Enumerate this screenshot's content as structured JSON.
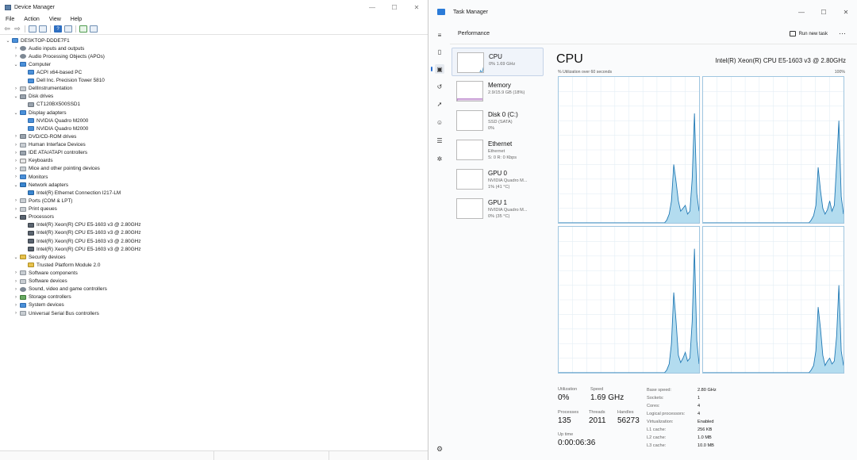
{
  "device_manager": {
    "title": "Device Manager",
    "menu": [
      "File",
      "Action",
      "View",
      "Help"
    ],
    "tree": [
      {
        "level": 0,
        "chev": "⌄",
        "icon": "monitor",
        "label": "DESKTOP-DDDE7F1"
      },
      {
        "level": 1,
        "chev": "›",
        "icon": "sound",
        "label": "Audio inputs and outputs"
      },
      {
        "level": 1,
        "chev": "›",
        "icon": "sound",
        "label": "Audio Processing Objects (APOs)"
      },
      {
        "level": 1,
        "chev": "⌄",
        "icon": "monitor",
        "label": "Computer"
      },
      {
        "level": 2,
        "chev": "",
        "icon": "monitor",
        "label": "ACPI x64-based PC"
      },
      {
        "level": 2,
        "chev": "",
        "icon": "monitor",
        "label": "Dell Inc. Precision Tower 5810"
      },
      {
        "level": 1,
        "chev": "›",
        "icon": "gray",
        "label": "DellInstrumentation"
      },
      {
        "level": 1,
        "chev": "⌄",
        "icon": "disk",
        "label": "Disk drives"
      },
      {
        "level": 2,
        "chev": "",
        "icon": "disk",
        "label": "CT120BX500SSD1"
      },
      {
        "level": 1,
        "chev": "⌄",
        "icon": "monitor",
        "label": "Display adapters"
      },
      {
        "level": 2,
        "chev": "",
        "icon": "monitor",
        "label": "NVIDIA Quadro M2000"
      },
      {
        "level": 2,
        "chev": "",
        "icon": "monitor",
        "label": "NVIDIA Quadro M2000"
      },
      {
        "level": 1,
        "chev": "›",
        "icon": "disk",
        "label": "DVD/CD-ROM drives"
      },
      {
        "level": 1,
        "chev": "›",
        "icon": "gray",
        "label": "Human Interface Devices"
      },
      {
        "level": 1,
        "chev": "›",
        "icon": "disk",
        "label": "IDE ATA/ATAPI controllers"
      },
      {
        "level": 1,
        "chev": "›",
        "icon": "key",
        "label": "Keyboards"
      },
      {
        "level": 1,
        "chev": "›",
        "icon": "gray",
        "label": "Mice and other pointing devices"
      },
      {
        "level": 1,
        "chev": "›",
        "icon": "monitor",
        "label": "Monitors"
      },
      {
        "level": 1,
        "chev": "⌄",
        "icon": "net",
        "label": "Network adapters"
      },
      {
        "level": 2,
        "chev": "",
        "icon": "net",
        "label": "Intel(R) Ethernet Connection I217-LM"
      },
      {
        "level": 1,
        "chev": "›",
        "icon": "gray",
        "label": "Ports (COM & LPT)"
      },
      {
        "level": 1,
        "chev": "›",
        "icon": "gray",
        "label": "Print queues"
      },
      {
        "level": 1,
        "chev": "⌄",
        "icon": "chip",
        "label": "Processors"
      },
      {
        "level": 2,
        "chev": "",
        "icon": "chip",
        "label": "Intel(R) Xeon(R) CPU E5-1603 v3 @ 2.80GHz"
      },
      {
        "level": 2,
        "chev": "",
        "icon": "chip",
        "label": "Intel(R) Xeon(R) CPU E5-1603 v3 @ 2.80GHz"
      },
      {
        "level": 2,
        "chev": "",
        "icon": "chip",
        "label": "Intel(R) Xeon(R) CPU E5-1603 v3 @ 2.80GHz"
      },
      {
        "level": 2,
        "chev": "",
        "icon": "chip",
        "label": "Intel(R) Xeon(R) CPU E5-1603 v3 @ 2.80GHz"
      },
      {
        "level": 1,
        "chev": "⌄",
        "icon": "yellow",
        "label": "Security devices"
      },
      {
        "level": 2,
        "chev": "",
        "icon": "yellow",
        "label": "Trusted Platform Module 2.0"
      },
      {
        "level": 1,
        "chev": "›",
        "icon": "gray",
        "label": "Software components"
      },
      {
        "level": 1,
        "chev": "›",
        "icon": "gray",
        "label": "Software devices"
      },
      {
        "level": 1,
        "chev": "›",
        "icon": "sound",
        "label": "Sound, video and game controllers"
      },
      {
        "level": 1,
        "chev": "›",
        "icon": "green",
        "label": "Storage controllers"
      },
      {
        "level": 1,
        "chev": "›",
        "icon": "monitor",
        "label": "System devices"
      },
      {
        "level": 1,
        "chev": "›",
        "icon": "gray",
        "label": "Universal Serial Bus controllers"
      }
    ]
  },
  "task_manager": {
    "title": "Task Manager",
    "page": "Performance",
    "run_new_task": "Run new task",
    "items": [
      {
        "name": "CPU",
        "sub1": "0% 1.69 GHz",
        "sub2": "",
        "color": "#3c8dc4"
      },
      {
        "name": "Memory",
        "sub1": "2.9/15.9 GB (18%)",
        "sub2": "",
        "color": "#9b4fb5"
      },
      {
        "name": "Disk 0 (C:)",
        "sub1": "SSD (SATA)",
        "sub2": "0%",
        "color": "#4d9a3a"
      },
      {
        "name": "Ethernet",
        "sub1": "Ethernet",
        "sub2": "S: 0 R: 0 Kbps",
        "color": "#a35b52"
      },
      {
        "name": "GPU 0",
        "sub1": "NVIDIA Quadro M...",
        "sub2": "1% (41 °C)",
        "color": "#7b5cc1"
      },
      {
        "name": "GPU 1",
        "sub1": "NVIDIA Quadro M...",
        "sub2": "0% (35 °C)",
        "color": "#7b5cc1"
      }
    ],
    "cpu": {
      "heading": "CPU",
      "model": "Intel(R) Xeon(R) CPU E5-1603 v3 @ 2.80GHz",
      "util_label": "% Utilization over 60 seconds",
      "max_label": "100%",
      "graph_color": "#1f78b4",
      "fill_color": "#b3dcef",
      "graph_series": [
        [
          0,
          0,
          0,
          0,
          0,
          0,
          0,
          0,
          0,
          0,
          0,
          0,
          0,
          0,
          0,
          0,
          0,
          0,
          0,
          0,
          0,
          0,
          0,
          0,
          0,
          0,
          0,
          0,
          0,
          0,
          0,
          0,
          0,
          0,
          0,
          0,
          0,
          0,
          0,
          0,
          0,
          0,
          0,
          0,
          0,
          0,
          0,
          2,
          6,
          15,
          40,
          28,
          15,
          8,
          10,
          12,
          6,
          8,
          30,
          75,
          20,
          8
        ],
        [
          0,
          0,
          0,
          0,
          0,
          0,
          0,
          0,
          0,
          0,
          0,
          0,
          0,
          0,
          0,
          0,
          0,
          0,
          0,
          0,
          0,
          0,
          0,
          0,
          0,
          0,
          0,
          0,
          0,
          0,
          0,
          0,
          0,
          0,
          0,
          0,
          0,
          0,
          0,
          0,
          0,
          0,
          0,
          0,
          0,
          0,
          0,
          2,
          5,
          12,
          38,
          22,
          10,
          6,
          9,
          15,
          8,
          12,
          40,
          70,
          18,
          6
        ],
        [
          0,
          0,
          0,
          0,
          0,
          0,
          0,
          0,
          0,
          0,
          0,
          0,
          0,
          0,
          0,
          0,
          0,
          0,
          0,
          0,
          0,
          0,
          0,
          0,
          0,
          0,
          0,
          0,
          0,
          0,
          0,
          0,
          0,
          0,
          0,
          0,
          0,
          0,
          0,
          0,
          0,
          0,
          0,
          0,
          0,
          0,
          0,
          2,
          6,
          20,
          55,
          35,
          12,
          7,
          10,
          14,
          8,
          10,
          35,
          85,
          22,
          6
        ],
        [
          0,
          0,
          0,
          0,
          0,
          0,
          0,
          0,
          0,
          0,
          0,
          0,
          0,
          0,
          0,
          0,
          0,
          0,
          0,
          0,
          0,
          0,
          0,
          0,
          0,
          0,
          0,
          0,
          0,
          0,
          0,
          0,
          0,
          0,
          0,
          0,
          0,
          0,
          0,
          0,
          0,
          0,
          0,
          0,
          0,
          0,
          0,
          2,
          5,
          15,
          45,
          30,
          12,
          5,
          8,
          10,
          6,
          8,
          25,
          60,
          15,
          5
        ]
      ],
      "stats": {
        "utilization_label": "Utilization",
        "utilization": "0%",
        "speed_label": "Speed",
        "speed": "1.69 GHz",
        "processes_label": "Processes",
        "processes": "135",
        "threads_label": "Threads",
        "threads": "2011",
        "handles_label": "Handles",
        "handles": "56273",
        "uptime_label": "Up time",
        "uptime": "0:00:06:36"
      },
      "specs": [
        {
          "k": "Base speed:",
          "v": "2.80 GHz"
        },
        {
          "k": "Sockets:",
          "v": "1"
        },
        {
          "k": "Cores:",
          "v": "4"
        },
        {
          "k": "Logical processors:",
          "v": "4"
        },
        {
          "k": "Virtualization:",
          "v": "Enabled"
        },
        {
          "k": "L1 cache:",
          "v": "256 KB"
        },
        {
          "k": "L2 cache:",
          "v": "1.0 MB"
        },
        {
          "k": "L3 cache:",
          "v": "10.0 MB"
        }
      ]
    }
  }
}
